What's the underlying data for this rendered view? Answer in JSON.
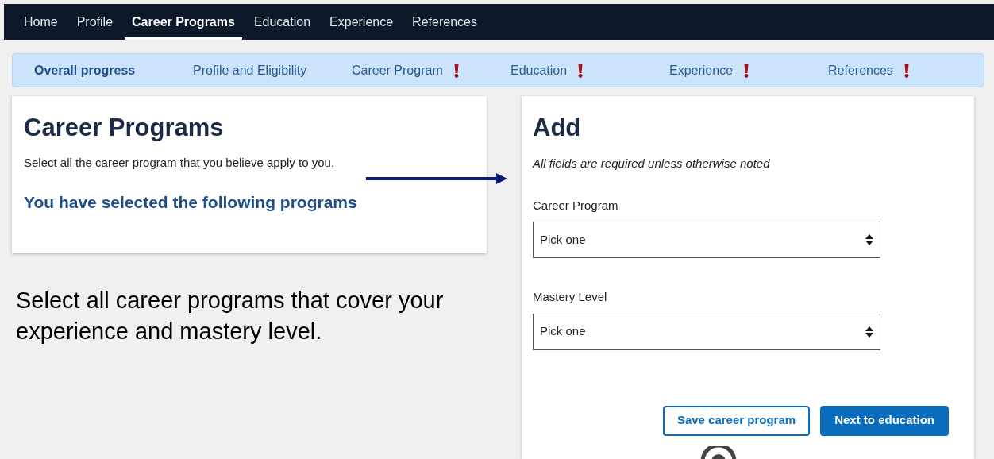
{
  "nav": [
    {
      "label": "Home",
      "selected": false
    },
    {
      "label": "Profile",
      "selected": false
    },
    {
      "label": "Career Programs",
      "selected": true
    },
    {
      "label": "Education",
      "selected": false
    },
    {
      "label": "Experience",
      "selected": false
    },
    {
      "label": "References",
      "selected": false
    }
  ],
  "progress": [
    {
      "label": "Overall progress",
      "selected": true,
      "alert": false
    },
    {
      "label": "Profile and Eligibility",
      "selected": false,
      "alert": false
    },
    {
      "label": "Career Program",
      "selected": false,
      "alert": true
    },
    {
      "label": "Education",
      "selected": false,
      "alert": true
    },
    {
      "label": "Experience",
      "selected": false,
      "alert": true
    },
    {
      "label": "References",
      "selected": false,
      "alert": true
    }
  ],
  "left_card": {
    "title": "Career Programs",
    "text": "Select all the career program that you believe apply to you.",
    "subtitle": "You have selected the following programs"
  },
  "annotation": "Select all career programs that cover your experience and mastery level.",
  "add_card": {
    "title": "Add",
    "note": "All fields are required unless otherwise noted",
    "fields": [
      {
        "label": "Career Program",
        "value": "Pick one"
      },
      {
        "label": "Mastery Level",
        "value": "Pick one"
      }
    ],
    "buttons": [
      {
        "label": "Save career program",
        "kind": "secondary"
      },
      {
        "label": "Next to education",
        "kind": "primary"
      }
    ]
  }
}
